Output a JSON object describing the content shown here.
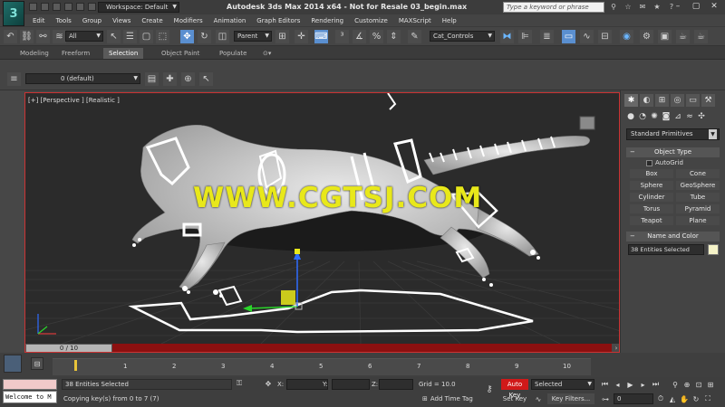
{
  "titlebar": {
    "workspace_label": "Workspace: Default",
    "window_title": "Autodesk 3ds Max  2014 x64  -  Not for Resale    03_begin.max",
    "search_placeholder": "Type a keyword or phrase"
  },
  "menu": [
    "Edit",
    "Tools",
    "Group",
    "Views",
    "Create",
    "Modifiers",
    "Animation",
    "Graph Editors",
    "Rendering",
    "Customize",
    "MAXScript",
    "Help"
  ],
  "toolbar": {
    "selection_filter": "All",
    "reference_coord": "Parent",
    "named_selection": "Cat_Controls"
  },
  "ribbon_tabs": [
    {
      "label": "Modeling",
      "selected": false
    },
    {
      "label": "Freeform",
      "selected": false
    },
    {
      "label": "Selection",
      "selected": true
    },
    {
      "label": "Object Paint",
      "selected": false
    },
    {
      "label": "Populate",
      "selected": false
    }
  ],
  "layer": {
    "current": "0 (default)"
  },
  "viewport": {
    "label": "[+] [Perspective ] [Realistic ]",
    "watermark": "WWW.CGTSJ.COM",
    "time_slider": "0 / 10"
  },
  "command_panel": {
    "category": "Standard Primitives",
    "object_type_title": "Object Type",
    "autogrid_label": "AutoGrid",
    "primitives": [
      "Box",
      "Cone",
      "Sphere",
      "GeoSphere",
      "Cylinder",
      "Tube",
      "Torus",
      "Pyramid",
      "Teapot",
      "Plane"
    ],
    "name_color_title": "Name and Color",
    "name_value": "38 Entities Selected",
    "swatch_color": "#f5f3c8"
  },
  "trackbar": {
    "frame_labels": [
      "1",
      "2",
      "3",
      "4",
      "5",
      "6",
      "7",
      "8",
      "9",
      "10"
    ]
  },
  "status": {
    "maxscript_text": "Welcome to M",
    "selection_text": "38 Entities Selected",
    "prompt_text": "Copying key(s) from 0 to 7 (7)",
    "x_label": "X:",
    "y_label": "Y:",
    "z_label": "Z:",
    "grid_text": "Grid = 10.0",
    "add_time_tag": "Add Time Tag",
    "auto_key": "Auto Key",
    "set_key": "Set Key",
    "selected_dd": "Selected",
    "key_filters": "Key Filters...",
    "current_frame": "0"
  }
}
